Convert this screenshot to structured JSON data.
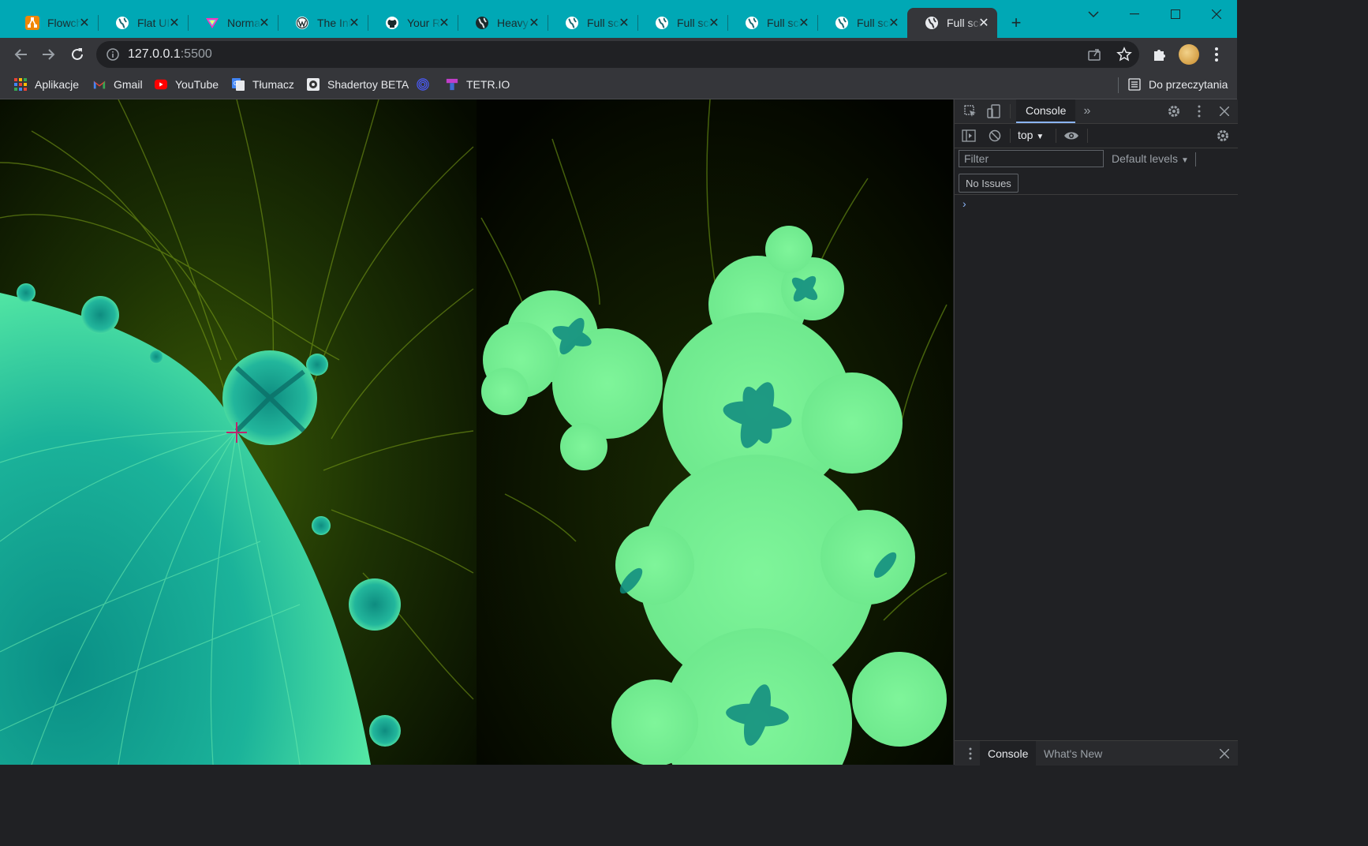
{
  "colors": {
    "tabstrip": "#00a8b5",
    "toolbar": "#35363a",
    "devtools_bg": "#202124",
    "fractal_light": "#7ff59a",
    "fractal_dark": "#0e8a7f",
    "fractal_bg_glow": "#6a8f10",
    "crosshair": "#c0246e"
  },
  "tabs": [
    {
      "title": "Flowchart",
      "icon": "drawio-icon",
      "active": false
    },
    {
      "title": "Flat UI",
      "icon": "globe-icon",
      "active": false
    },
    {
      "title": "Normal",
      "icon": "triangle-logo-icon",
      "active": false
    },
    {
      "title": "The Internet",
      "icon": "wordpress-icon",
      "active": false
    },
    {
      "title": "Your Repositories",
      "icon": "github-icon",
      "active": false
    },
    {
      "title": "Heavy",
      "icon": "globe-dark-icon",
      "active": false
    },
    {
      "title": "Full screen",
      "icon": "globe-icon",
      "active": false
    },
    {
      "title": "Full screen",
      "icon": "globe-icon",
      "active": false
    },
    {
      "title": "Full screen",
      "icon": "globe-icon",
      "active": false
    },
    {
      "title": "Full screen",
      "icon": "globe-icon",
      "active": false
    },
    {
      "title": "Full screen",
      "icon": "globe-icon",
      "active": true
    }
  ],
  "address": {
    "host": "127.0.0.1",
    "port": ":5500"
  },
  "bookmarks": [
    {
      "label": "Aplikacje",
      "icon": "apps-grid-icon"
    },
    {
      "label": "Gmail",
      "icon": "gmail-icon"
    },
    {
      "label": "YouTube",
      "icon": "youtube-icon"
    },
    {
      "label": "Tłumacz",
      "icon": "translate-icon"
    },
    {
      "label": "Shadertoy BETA",
      "icon": "shadertoy-icon"
    },
    {
      "label": "",
      "icon": "spiral-icon"
    },
    {
      "label": "TETR.IO",
      "icon": "tetrio-icon"
    }
  ],
  "reading_list": "Do przeczytania",
  "devtools": {
    "tab_console": "Console",
    "context": "top",
    "filter_placeholder": "Filter",
    "levels": "Default levels",
    "issues": "No Issues",
    "prompt": "›",
    "drawer_console": "Console",
    "drawer_whats_new": "What's New"
  }
}
